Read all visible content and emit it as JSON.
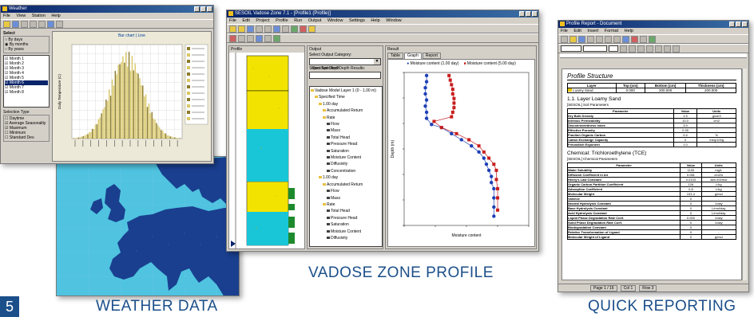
{
  "colors": {
    "accent": "#1b4f8a",
    "title_bar": "#0a246a",
    "map_sea": "#4fc3e0",
    "map_land": "#1a3f8f",
    "soil_yellow": "#f2e400",
    "soil_cyan": "#18c6d8"
  },
  "captions": {
    "weather": "WEATHER DATA",
    "vadose": "VADOSE ZONE PROFILE",
    "reporting": "QUICK REPORTING",
    "page_number": "5"
  },
  "weather_window": {
    "title": "Weather",
    "menu": [
      "File",
      "View",
      "Station",
      "Help"
    ],
    "station_label": "Select",
    "station_options": [
      "By days",
      "By months",
      "By years"
    ],
    "months_checked": [
      "Month 1",
      "Month 2",
      "Month 3",
      "Month 4",
      "Month 5",
      "Month 6",
      "Month 7",
      "Month 8"
    ],
    "selection_type_label": "Selection Type",
    "selection_types": [
      "Daytime",
      "Average Seasonality",
      "Maximum",
      "Minimum",
      "Standard Dev."
    ],
    "chart_title": "Bar chart   |   Line",
    "ylabel": "Daily Temperature (C)"
  },
  "vadose_window": {
    "title": "SESOIL Vadose Zone 7.1 - [Profile1 (Profile)]",
    "menu": [
      "File",
      "Edit",
      "Project",
      "Profile",
      "Run",
      "Output",
      "Window",
      "Settings",
      "Help",
      "Window"
    ],
    "profile_pane_title": "Profile",
    "output_pane_title": "Output",
    "select_output_label": "Select Output Category:",
    "output_category": "Specified Depth",
    "depth_results_label": "Select Specified Depth Results:",
    "tree_items": [
      "Vadose Model Layer 1 (0 - 1.00 m)",
      "Specified Time",
      "1.00 day",
      "Accumulated Return",
      "Rate",
      "Flow",
      "Mass",
      "Total Head",
      "Pressure Head",
      "Saturation",
      "Moisture Content",
      "Diffusivity",
      "Concentration",
      "1.00 day",
      "Accumulated Return",
      "Flow",
      "Mass",
      "Rate",
      "Total Head",
      "Pressure Head",
      "Saturation",
      "Moisture Content",
      "Diffusivity"
    ],
    "result_pane_title": "Result",
    "result_tabs": [
      "Table",
      "Graph",
      "Report"
    ],
    "legend": [
      "Moisture content (1.00 day)",
      "Moisture content (5.00 day)"
    ],
    "xlabel": "Moisture content",
    "ylabel": "Depth (m)"
  },
  "report_window": {
    "title": "Profile Report - Document",
    "menu": [
      "File",
      "Edit",
      "Insert",
      "Format",
      "Help"
    ],
    "heading": "Profile Structure",
    "structure_headers": [
      "Layer",
      "Top (cm)",
      "Bottom (cm)",
      "Thickness (cm)"
    ],
    "structure_row": [
      "Loamy Sand",
      "0.000",
      "200.000",
      "200.000"
    ],
    "section1_title": "1.1. Layer Loamy Sand",
    "section1_sub": "[SESOIL] Soil Parameters",
    "param_headers": [
      "Parameter",
      "Value",
      "Units"
    ],
    "params1": [
      [
        "Dry Bulk Density",
        "1.5",
        "g/cm3"
      ],
      [
        "Intrinsic Permeability",
        "10.0",
        "cm2"
      ],
      [
        "Disconnectedness Index",
        "3.9",
        "-"
      ],
      [
        "Effective Porosity",
        "0.35",
        "-"
      ],
      [
        "Fraction Organic Carbon",
        "0.4",
        "%"
      ],
      [
        "Cation Exchange Capacity",
        "0",
        "meq/100g"
      ],
      [
        "Freundlich Exponent",
        "1.0",
        "-"
      ]
    ],
    "section2_title": "Chemical: Trichloroethylene (TCE)",
    "section2_sub": "[SESOIL] Chemical Parameters",
    "params2": [
      [
        "Water Solubility",
        "1100",
        "mg/L"
      ],
      [
        "Diffusion Coefficient in Air",
        "0.081",
        "cm2/s"
      ],
      [
        "Henry's Law Constant",
        "0.0103",
        "atm m3/mol"
      ],
      [
        "Organic Carbon Partition Coefficient",
        "126",
        "L/kg"
      ],
      [
        "Adsorption Coefficient",
        "0.8",
        "L/kg"
      ],
      [
        "Molecular Weight",
        "131.4",
        "g/mol"
      ],
      [
        "Valence",
        "0",
        "-"
      ],
      [
        "Neutral Hydrolysis Constant",
        "0",
        "1/day"
      ],
      [
        "Base Hydrolysis Constant",
        "0",
        "L/mol/day"
      ],
      [
        "Acid Hydrolysis Constant",
        "0",
        "L/mol/day"
      ],
      [
        "Liquid Phase Degradation Rate Coef.",
        "0.000",
        "1/day"
      ],
      [
        "Solid Phase Degradation Rate Coef.",
        "0",
        "1/day"
      ],
      [
        "Biodegradation Constant",
        "0",
        "-"
      ],
      [
        "Relative Transformation of Ligand",
        "0",
        "-"
      ],
      [
        "Molecular Weight of Ligand",
        "0",
        "g/mol"
      ]
    ],
    "statusbar": [
      "Page 1 / 16",
      "Col 1",
      "Row 3"
    ]
  }
}
